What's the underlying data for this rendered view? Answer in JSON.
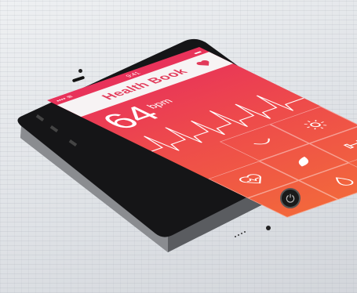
{
  "status_bar": {
    "left": "•••• ≋",
    "time": "9:41",
    "right": "▬"
  },
  "app": {
    "title": "Health Book"
  },
  "heart_rate": {
    "value": "64",
    "unit": "bpm"
  },
  "tiles": [
    {
      "icon": "blank-tile",
      "label": ""
    },
    {
      "icon": "scale-icon",
      "label": ""
    },
    {
      "icon": "sun-icon",
      "label": ""
    },
    {
      "icon": "heart-pulse-icon",
      "label": ""
    },
    {
      "icon": "leaf-icon",
      "label": ""
    },
    {
      "icon": "dumbbell-icon",
      "label": ""
    },
    {
      "icon": "feather-icon",
      "label": ""
    },
    {
      "icon": "drop-icon",
      "label": ""
    },
    {
      "icon": "blank-tile",
      "label": ""
    }
  ],
  "colors": {
    "accent_top": "#e8315a",
    "accent_bottom": "#f2673c",
    "title_color": "#e23a5a"
  }
}
